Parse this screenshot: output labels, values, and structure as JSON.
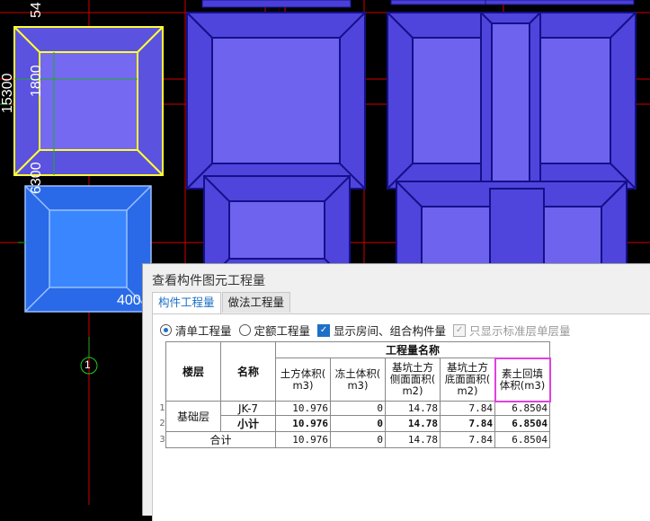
{
  "drawing": {
    "dim_1800": "1800",
    "dim_6300": "6300",
    "dim_15300": "15300",
    "dim_54": "54",
    "dim_400": "400",
    "axis_label": "1"
  },
  "dialog": {
    "title": "查看构件图元工程量",
    "tabs": [
      "构件工程量",
      "做法工程量"
    ],
    "options": {
      "qingdan": "清单工程量",
      "dinge": "定额工程量",
      "show_rooms": "显示房间、组合构件量",
      "std_floor_only": "只显示标准层单层量"
    },
    "table": {
      "header_floor": "楼层",
      "header_name": "名称",
      "header_group": "工程量名称",
      "cols": [
        "土方体积(\nm3)",
        "冻土体积(\nm3)",
        "基坑土方\n侧面面积(\nm2)",
        "基坑土方\n底面面积(\nm2)",
        "素土回填\n体积(m3)"
      ],
      "row_numbers": [
        "1",
        "2",
        "3"
      ],
      "floor": "基础层",
      "rows": [
        {
          "name": "JK-7",
          "values": [
            "10.976",
            "0",
            "14.78",
            "7.84",
            "6.8504"
          ]
        },
        {
          "name": "小计",
          "values": [
            "10.976",
            "0",
            "14.78",
            "7.84",
            "6.8504"
          ]
        }
      ],
      "total_label": "合计",
      "total_values": [
        "10.976",
        "0",
        "14.78",
        "7.84",
        "6.8504"
      ]
    }
  }
}
